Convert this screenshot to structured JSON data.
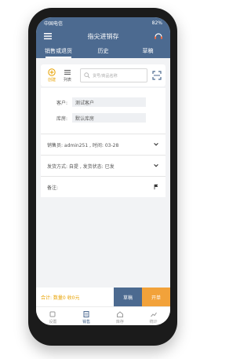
{
  "status": {
    "carrier": "中国电信",
    "battery": "82%"
  },
  "title": "指尖进销存",
  "tabs": [
    "销售或退货",
    "历史",
    "草稿"
  ],
  "toolbar": {
    "create_label": "创建",
    "list_label": "列表",
    "search_placeholder": "货号/商品名称"
  },
  "form": {
    "customer_label": "客户:",
    "customer_value": "测试客户",
    "warehouse_label": "库房:",
    "warehouse_value": "默认库房"
  },
  "lines": [
    "销售员: admin251 , 时间: 03-28",
    "发货方式: 自提 , 发货状态: 已发",
    "备注:"
  ],
  "summary": "合计: 数量0 收0元",
  "buttons": {
    "draft": "草稿",
    "create": "开单"
  },
  "nav": [
    "设置",
    "销售",
    "库存",
    "统计"
  ]
}
